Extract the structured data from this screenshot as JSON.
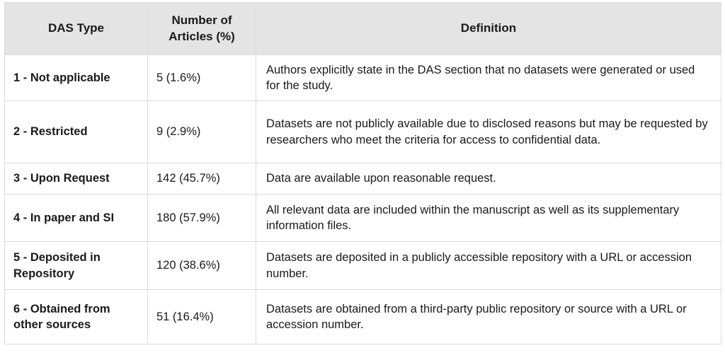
{
  "table": {
    "columns": [
      {
        "key": "das_type",
        "label": "DAS Type"
      },
      {
        "key": "num_articles",
        "label": "Number of\nArticles (%)"
      },
      {
        "key": "definition",
        "label": "Definition"
      }
    ],
    "header": {
      "col1": "DAS Type",
      "col2_line1": "Number of",
      "col2_line2": "Articles (%)",
      "col3": "Definition"
    },
    "rows": [
      {
        "das_type": "1 - Not applicable",
        "count_display": "5 (1.6%)",
        "count": 5,
        "percent": 1.6,
        "definition": "Authors explicitly state in the DAS section that no datasets were generated or used for the study."
      },
      {
        "das_type": "2 - Restricted",
        "count_display": "9 (2.9%)",
        "count": 9,
        "percent": 2.9,
        "definition": "Datasets are not publicly available due to disclosed reasons but may be requested by researchers who meet the criteria for access to confidential data."
      },
      {
        "das_type": "3 - Upon Request",
        "count_display": "142 (45.7%)",
        "count": 142,
        "percent": 45.7,
        "definition": "Data are available upon reasonable request."
      },
      {
        "das_type": "4 - In paper and SI",
        "count_display": "180 (57.9%)",
        "count": 180,
        "percent": 57.9,
        "definition": "All relevant data are included within the manuscript as well as its supplementary information files."
      },
      {
        "das_type": "5 - Deposited in Repository",
        "count_display": "120 (38.6%)",
        "count": 120,
        "percent": 38.6,
        "definition": "Datasets are deposited in a publicly accessible repository with a URL or accession number."
      },
      {
        "das_type": "6 - Obtained from other sources",
        "count_display": "51 (16.4%)",
        "count": 51,
        "percent": 16.4,
        "definition": "Datasets are obtained from a third-party public repository or source with a URL or accession number."
      }
    ]
  },
  "colors": {
    "header_background": "#e4e4e4",
    "body_background": "#ffffff",
    "border": "#dcdcdc",
    "text": "#1a1a1a"
  }
}
